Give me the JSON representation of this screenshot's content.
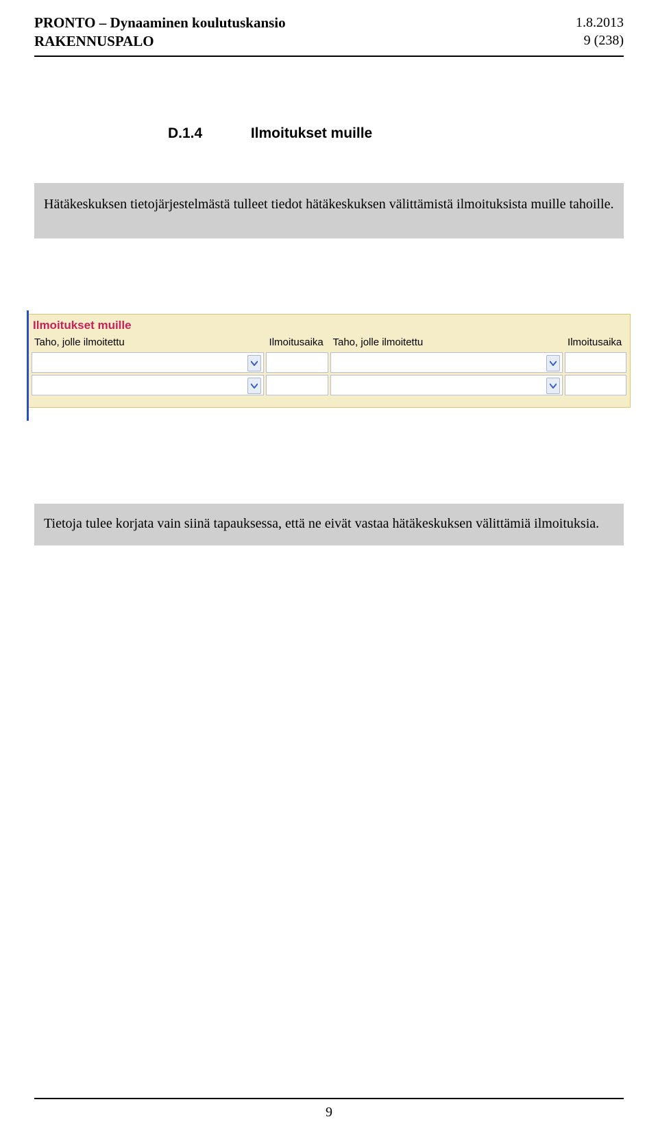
{
  "header": {
    "title_line1": "PRONTO – Dynaaminen koulutuskansio",
    "title_line2": "RAKENNUSPALO",
    "date": "1.8.2013",
    "page_indicator": "9 (238)"
  },
  "section": {
    "number": "D.1.4",
    "title": "Ilmoitukset muille"
  },
  "info1": "Hätäkeskuksen tietojärjestelmästä tulleet tiedot hätäkeskuksen välittämistä ilmoituksista muille tahoille.",
  "form": {
    "panel_title": "Ilmoitukset muille",
    "headers": {
      "taho": "Taho, jolle ilmoitettu",
      "aika": "Ilmoitusaika"
    }
  },
  "info2": "Tietoja tulee korjata vain siinä tapauksessa, että ne eivät vastaa hätäkeskuksen välittämiä ilmoituksia.",
  "footer": {
    "page_number": "9"
  }
}
